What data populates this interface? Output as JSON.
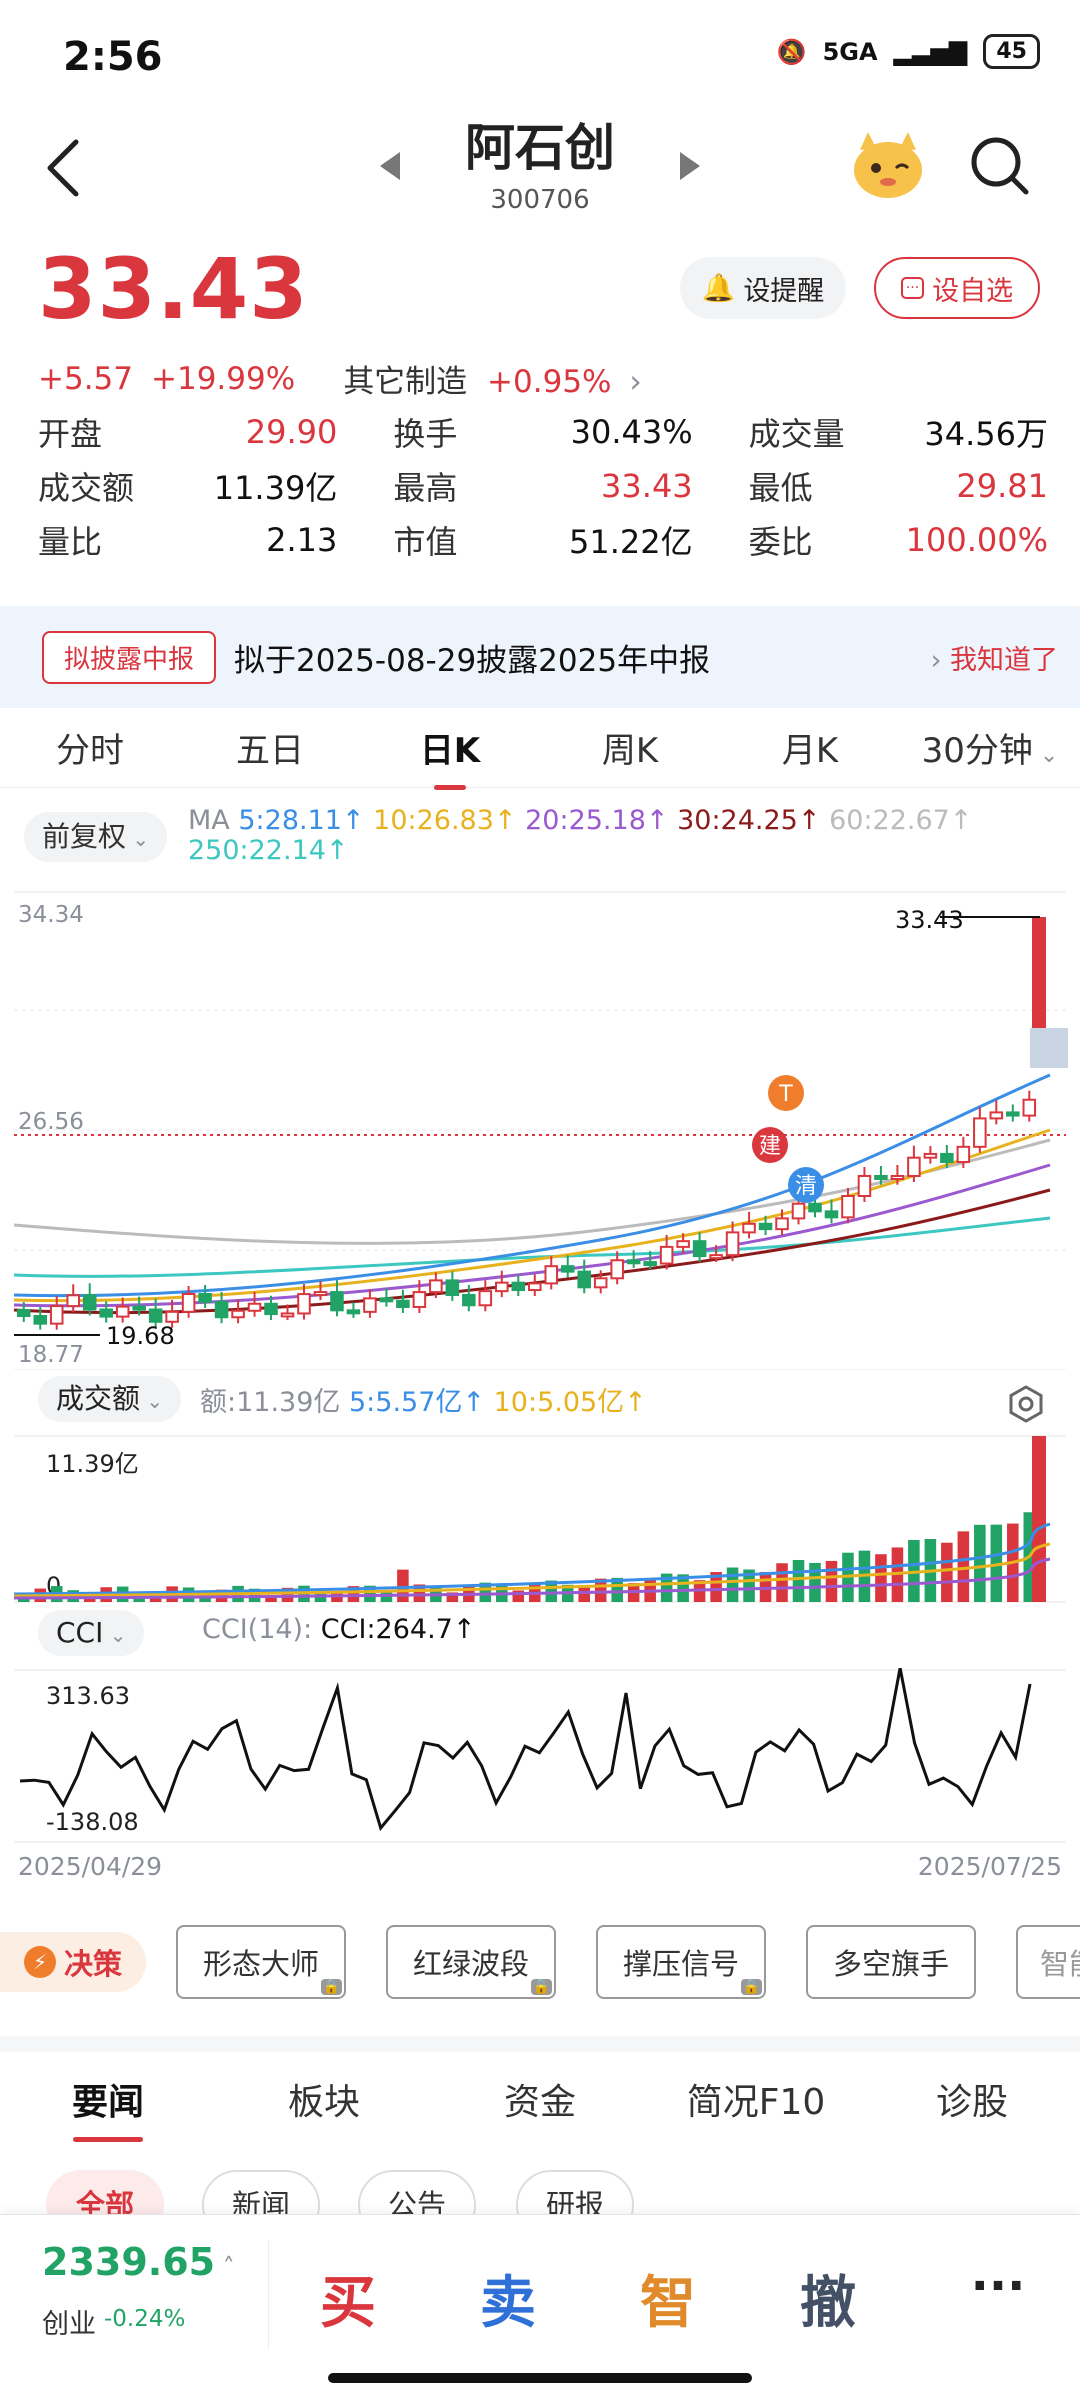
{
  "status": {
    "time": "2:56",
    "network": "5GA",
    "battery": "45"
  },
  "header": {
    "name": "阿石创",
    "code": "300706"
  },
  "price": {
    "current": "33.43",
    "change": "+5.57",
    "change_pct": "+19.99%",
    "sector": "其它制造",
    "sector_pct": "+0.95%"
  },
  "buttons": {
    "alert": "设提醒",
    "watch": "设自选"
  },
  "stats": [
    {
      "label": "开盘",
      "value": "29.90",
      "color": "red"
    },
    {
      "label": "换手",
      "value": "30.43%",
      "color": "black"
    },
    {
      "label": "成交量",
      "value": "34.56万",
      "color": "black"
    },
    {
      "label": "成交额",
      "value": "11.39亿",
      "color": "black"
    },
    {
      "label": "最高",
      "value": "33.43",
      "color": "red"
    },
    {
      "label": "最低",
      "value": "29.81",
      "color": "red"
    },
    {
      "label": "量比",
      "value": "2.13",
      "color": "black"
    },
    {
      "label": "市值",
      "value": "51.22亿",
      "color": "black"
    },
    {
      "label": "委比",
      "value": "100.00%",
      "color": "red"
    }
  ],
  "notice": {
    "tag": "拟披露中报",
    "text": "拟于2025-08-29披露2025年中报",
    "action": "我知道了"
  },
  "tabs": [
    "分时",
    "五日",
    "日K",
    "周K",
    "月K",
    "30分钟"
  ],
  "ma": {
    "adjust": "前复权",
    "prefix": "MA",
    "items": [
      {
        "label": "5:28.11↑",
        "color": "#3a8ee6"
      },
      {
        "label": "10:26.83↑",
        "color": "#e8b21f"
      },
      {
        "label": "20:25.18↑",
        "color": "#9b59d0"
      },
      {
        "label": "30:24.25↑",
        "color": "#8b1a1a"
      },
      {
        "label": "60:22.67↑",
        "color": "#bbbbbb"
      },
      {
        "label": "250:22.14↑",
        "color": "#3cc8c0"
      }
    ]
  },
  "kline": {
    "y_top": "34.34",
    "y_mid": "26.56",
    "y_bottom": "18.77",
    "high_label": "33.43",
    "low_label": "19.68",
    "markers": [
      "T",
      "建",
      "清"
    ]
  },
  "volume": {
    "label": "成交额",
    "amount": "额:11.39亿",
    "ma5": "5:5.57亿↑",
    "ma10": "10:5.05亿↑",
    "top": "11.39亿",
    "zero": "0"
  },
  "cci": {
    "label": "CCI",
    "param": "CCI(14):",
    "value": "CCI:264.7↑",
    "top": "313.63",
    "bottom": "-138.08"
  },
  "dates": {
    "start": "2025/04/29",
    "end": "2025/07/25"
  },
  "tools": {
    "decision": "决策",
    "items": [
      "形态大师",
      "红绿波段",
      "撑压信号",
      "多空旗手",
      "智能"
    ]
  },
  "news_tabs": [
    "要闻",
    "板块",
    "资金",
    "简况F10",
    "诊股"
  ],
  "news_chips": [
    "全部",
    "新闻",
    "公告",
    "研报"
  ],
  "bottom": {
    "index_value": "2339.65",
    "index_name": "创业",
    "index_change": "-0.24%",
    "actions": [
      "买",
      "卖",
      "智",
      "撤",
      "···"
    ]
  },
  "colors": {
    "up": "#d9363e",
    "down": "#21a366",
    "accent": "#d9363e"
  }
}
